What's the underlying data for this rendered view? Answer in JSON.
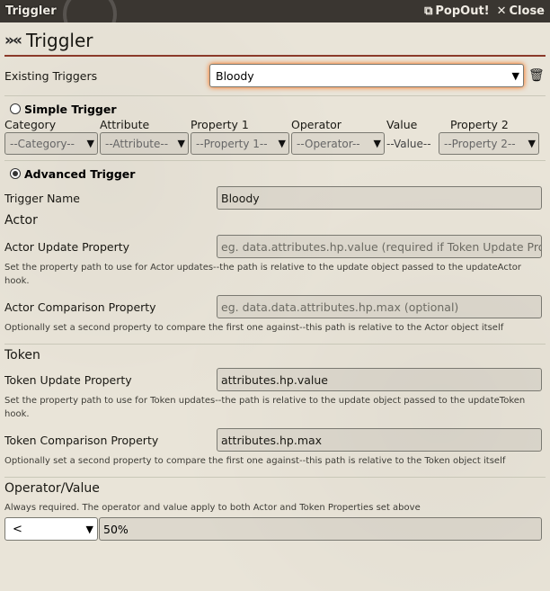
{
  "window": {
    "title": "Triggler",
    "popout_label": "PopOut!",
    "close_label": "Close",
    "popout_icon": "external-link-icon",
    "close_icon": "close-icon"
  },
  "header": {
    "icon": "triggler-logo-icon",
    "title": "Triggler"
  },
  "existing": {
    "label": "Existing Triggers",
    "selected": "Bloody"
  },
  "simple": {
    "label": "Simple Trigger",
    "checked": false,
    "columns": [
      {
        "label": "Category",
        "value": "--Category--"
      },
      {
        "label": "Attribute",
        "value": "--Attribute--"
      },
      {
        "label": "Property 1",
        "value": "--Property 1--"
      },
      {
        "label": "Operator",
        "value": "--Operator--"
      },
      {
        "label": "Value",
        "value": "--Value--"
      },
      {
        "label": "Property 2",
        "value": "--Property 2--"
      }
    ]
  },
  "advanced": {
    "label": "Advanced Trigger",
    "checked": true,
    "trigger_name_label": "Trigger Name",
    "trigger_name_value": "Bloody",
    "actor": {
      "title": "Actor",
      "update_label": "Actor Update Property",
      "update_placeholder": "eg. data.attributes.hp.value (required if Token Update Property is blank)",
      "update_hint": "Set the property path to use for Actor updates--the path is relative to the update object passed to the updateActor hook.",
      "compare_label": "Actor Comparison Property",
      "compare_placeholder": "eg. data.data.attributes.hp.max (optional)",
      "compare_hint": "Optionally set a second property to compare the first one against--this path is relative to the Actor object itself"
    },
    "token": {
      "title": "Token",
      "update_label": "Token Update Property",
      "update_value": "attributes.hp.value",
      "update_hint": "Set the property path to use for Token updates--the path is relative to the update object passed to the updateToken hook.",
      "compare_label": "Token Comparison Property",
      "compare_value": "attributes.hp.max",
      "compare_hint": "Optionally set a second property to compare the first one against--this path is relative to the Token object itself"
    },
    "opval": {
      "title": "Operator/Value",
      "hint": "Always required. The operator and value apply to both Actor and Token Properties set above",
      "operator": "<",
      "value": "50%"
    }
  },
  "colors": {
    "accent": "#8b3a2a",
    "titlebar": "#3a3631",
    "focus_glow": "#ff6400"
  }
}
